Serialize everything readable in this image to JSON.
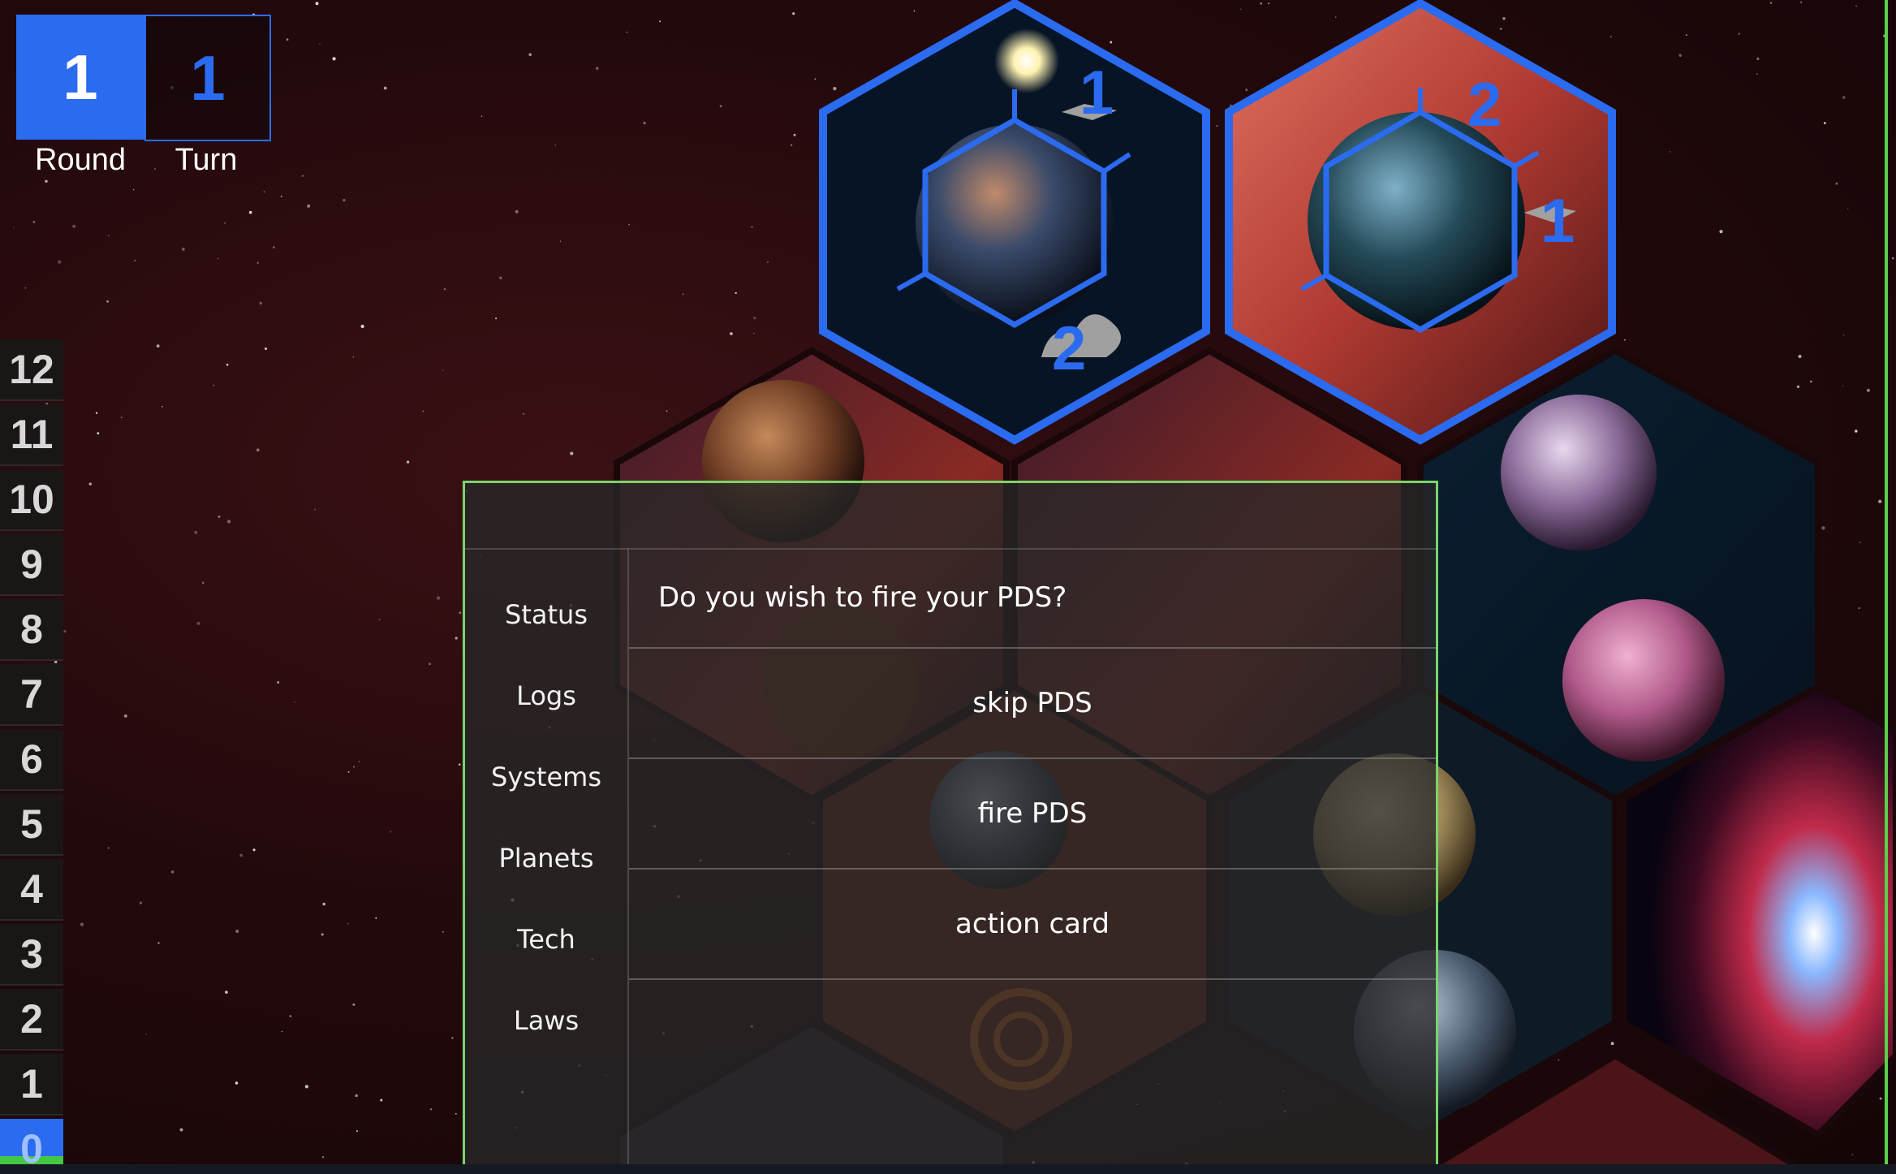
{
  "counter": {
    "round_value": "1",
    "round_label": "Round",
    "turn_value": "1",
    "turn_label": "Turn"
  },
  "vp_track": {
    "values": [
      "12",
      "11",
      "10",
      "9",
      "8",
      "7",
      "6",
      "5",
      "4",
      "3",
      "2",
      "1",
      "0"
    ],
    "current": "0"
  },
  "map": {
    "home_systems": [
      {
        "fleet_label": "1",
        "ground_label": "2"
      },
      {
        "fleet_label": "2",
        "ground_label": "1"
      }
    ]
  },
  "panel": {
    "nav": [
      "Status",
      "Logs",
      "Systems",
      "Planets",
      "Tech",
      "Laws"
    ],
    "prompt": "Do you wish to fire your PDS?",
    "options": [
      "skip PDS",
      "fire PDS",
      "action card"
    ]
  },
  "colors": {
    "player_blue": "#2b6bf0",
    "panel_border": "#7ad46a",
    "space": "#23090c"
  }
}
